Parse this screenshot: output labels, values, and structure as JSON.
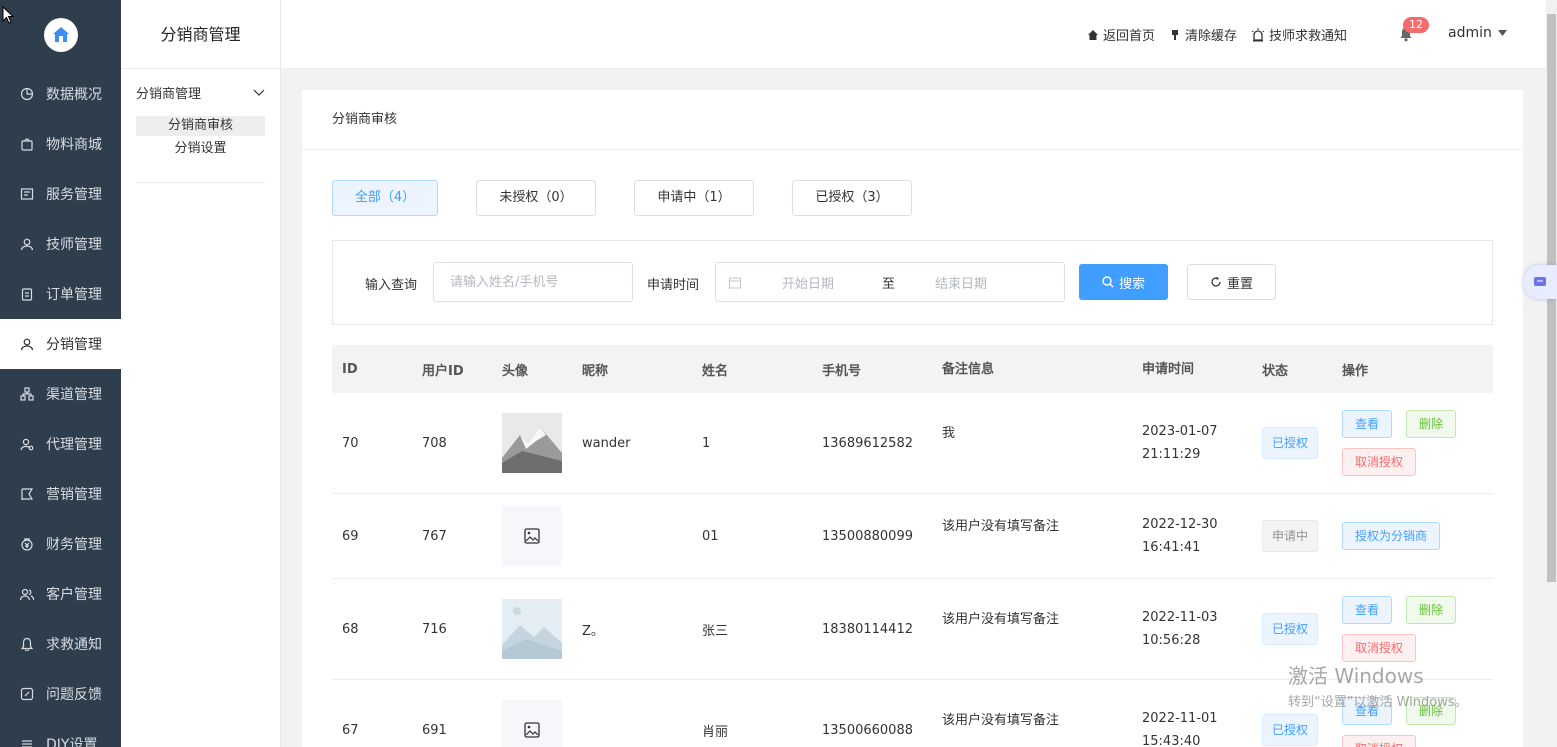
{
  "sidebar": {
    "items": [
      {
        "label": "数据概况",
        "icon": "pie-chart-icon"
      },
      {
        "label": "物料商城",
        "icon": "shopping-bag-icon"
      },
      {
        "label": "服务管理",
        "icon": "service-icon"
      },
      {
        "label": "技师管理",
        "icon": "user-icon"
      },
      {
        "label": "订单管理",
        "icon": "clipboard-icon"
      },
      {
        "label": "分销管理",
        "icon": "user-icon",
        "active": true
      },
      {
        "label": "渠道管理",
        "icon": "network-icon"
      },
      {
        "label": "代理管理",
        "icon": "user-gear-icon"
      },
      {
        "label": "营销管理",
        "icon": "marketing-icon"
      },
      {
        "label": "财务管理",
        "icon": "money-icon"
      },
      {
        "label": "客户管理",
        "icon": "users-icon"
      },
      {
        "label": "求救通知",
        "icon": "bell-icon"
      },
      {
        "label": "问题反馈",
        "icon": "edit-icon"
      },
      {
        "label": "DIY设置",
        "icon": "settings-icon"
      }
    ]
  },
  "submenu": {
    "title": "分销商管理",
    "group_label": "分销商管理",
    "links": [
      "分销商审核",
      "分销设置"
    ]
  },
  "header": {
    "actions": [
      "返回首页",
      "清除缓存",
      "技师求救通知"
    ],
    "badge_count": "12",
    "user": "admin"
  },
  "page": {
    "title": "分销商审核",
    "tabs": [
      "全部（4）",
      "未授权（0）",
      "申请中（1）",
      "已授权（3）"
    ],
    "active_tab": 0,
    "filter": {
      "query_label": "输入查询",
      "query_placeholder": "请输入姓名/手机号",
      "date_label": "申请时间",
      "date_start_placeholder": "开始日期",
      "date_separator": "至",
      "date_end_placeholder": "结束日期",
      "search_button": "搜索",
      "reset_button": "重置"
    }
  },
  "table": {
    "columns": [
      "ID",
      "用户ID",
      "头像",
      "昵称",
      "姓名",
      "手机号",
      "备注信息",
      "申请时间",
      "状态",
      "操作"
    ],
    "rows": [
      {
        "id": "70",
        "uid": "708",
        "avatar": "mountain-photo",
        "nick": "wander",
        "name": "1",
        "phone": "13689612582",
        "note": "我",
        "date": "2023-01-07",
        "time": "21:11:29",
        "status": "已授权",
        "ops": [
          "查看",
          "删除",
          "取消授权"
        ]
      },
      {
        "id": "69",
        "uid": "767",
        "avatar": "placeholder",
        "nick": "",
        "name": "01",
        "phone": "13500880099",
        "note": "该用户没有填写备注",
        "date": "2022-12-30",
        "time": "16:41:41",
        "status": "申请中",
        "ops": [
          "授权为分销商"
        ]
      },
      {
        "id": "68",
        "uid": "716",
        "avatar": "landscape-illustration",
        "nick": "Z。",
        "name": "张三",
        "phone": "18380114412",
        "note": "该用户没有填写备注",
        "date": "2022-11-03",
        "time": "10:56:28",
        "status": "已授权",
        "ops": [
          "查看",
          "删除",
          "取消授权"
        ]
      },
      {
        "id": "67",
        "uid": "691",
        "avatar": "placeholder",
        "nick": "",
        "name": "肖丽",
        "phone": "13500660088",
        "note": "该用户没有填写备注",
        "date": "2022-11-01",
        "time": "15:43:40",
        "status": "已授权",
        "ops": [
          "查看",
          "删除",
          "取消授权"
        ]
      }
    ]
  },
  "watermark": {
    "line1": "激活 Windows",
    "line2": "转到“设置”以激活 Windows。"
  },
  "colors": {
    "sidebar_bg": "#2f3e4c",
    "primary": "#409eff",
    "danger": "#f56c6c",
    "success": "#67c23a"
  }
}
